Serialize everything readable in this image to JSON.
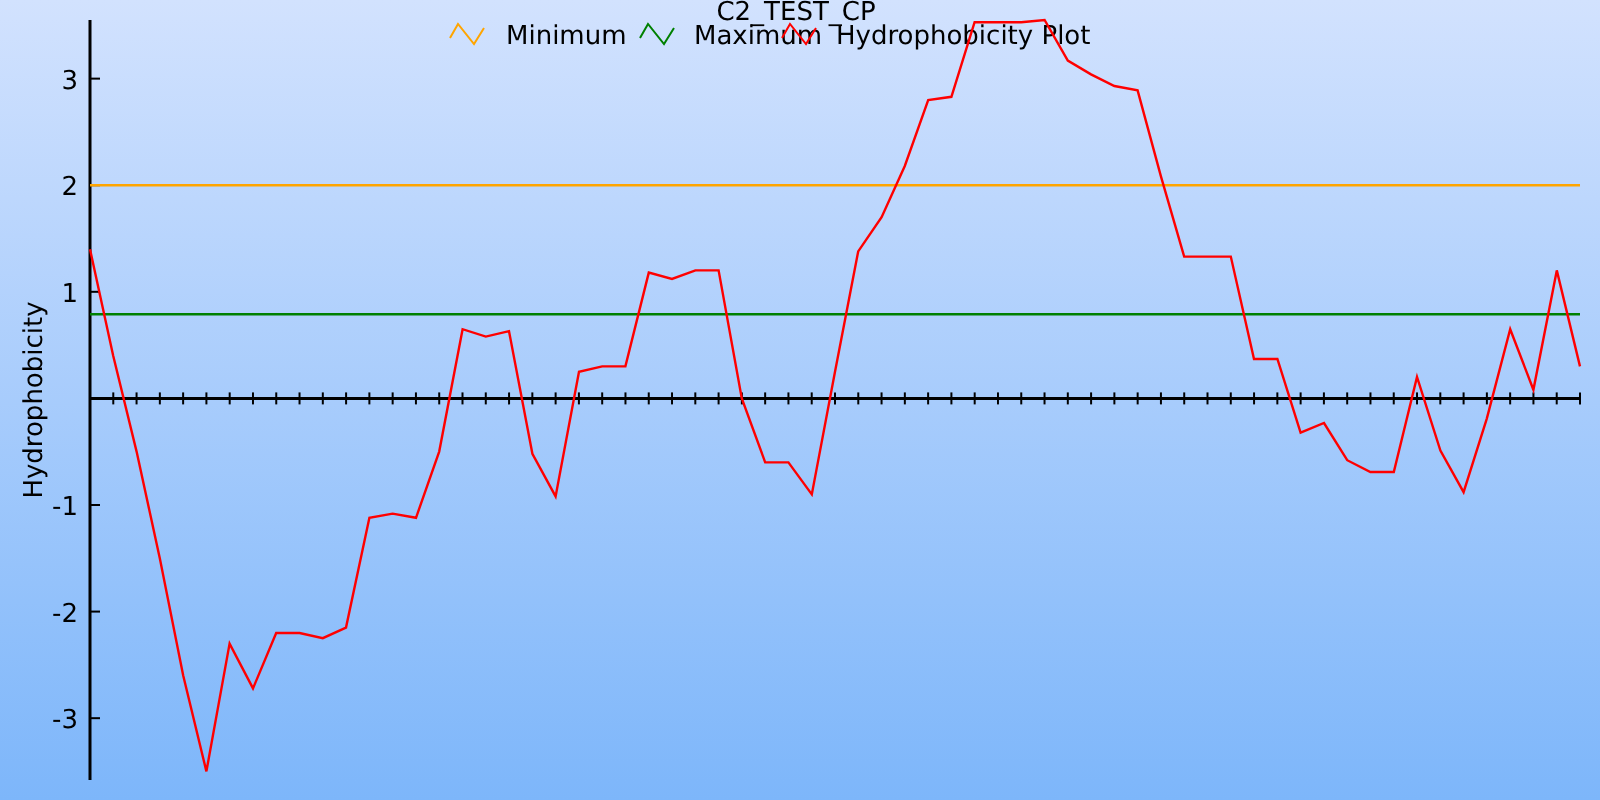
{
  "chart": {
    "chart_data": {
      "type": "line",
      "title": "C2_TEST_CP",
      "ylabel": "Hydrophobicity",
      "categories": [
        null,
        null,
        null,
        null,
        null,
        null,
        null,
        null,
        null,
        null,
        null,
        null,
        null,
        null,
        null,
        null,
        null,
        null,
        null,
        null,
        null,
        null,
        null,
        null,
        null,
        null,
        null,
        null,
        null,
        null,
        null,
        null,
        null,
        null,
        null,
        null,
        null,
        null,
        null,
        null,
        null,
        null,
        null,
        null,
        null,
        null,
        null,
        null,
        null,
        null,
        null,
        null,
        null,
        null,
        null,
        null,
        null,
        null,
        null,
        null,
        null,
        null,
        null,
        null,
        null
      ],
      "legend": "top",
      "ylim": [
        -3.58,
        3.55
      ],
      "yticks": [
        -3,
        -2,
        -1,
        1,
        2,
        3
      ],
      "series": [
        {
          "name": "Minimum",
          "color": "#ffa500",
          "values": [
            2,
            2,
            2,
            2,
            2,
            2,
            2,
            2,
            2,
            2,
            2,
            2,
            2,
            2,
            2,
            2,
            2,
            2,
            2,
            2,
            2,
            2,
            2,
            2,
            2,
            2,
            2,
            2,
            2,
            2,
            2,
            2,
            2,
            2,
            2,
            2,
            2,
            2,
            2,
            2,
            2,
            2,
            2,
            2,
            2,
            2,
            2,
            2,
            2,
            2,
            2,
            2,
            2,
            2,
            2,
            2,
            2,
            2,
            2,
            2,
            2,
            2,
            2,
            2,
            2
          ]
        },
        {
          "name": "Maximum",
          "color": "#008000",
          "values": [
            0.79,
            0.79,
            0.79,
            0.79,
            0.79,
            0.79,
            0.79,
            0.79,
            0.79,
            0.79,
            0.79,
            0.79,
            0.79,
            0.79,
            0.79,
            0.79,
            0.79,
            0.79,
            0.79,
            0.79,
            0.79,
            0.79,
            0.79,
            0.79,
            0.79,
            0.79,
            0.79,
            0.79,
            0.79,
            0.79,
            0.79,
            0.79,
            0.79,
            0.79,
            0.79,
            0.79,
            0.79,
            0.79,
            0.79,
            0.79,
            0.79,
            0.79,
            0.79,
            0.79,
            0.79,
            0.79,
            0.79,
            0.79,
            0.79,
            0.79,
            0.79,
            0.79,
            0.79,
            0.79,
            0.79,
            0.79,
            0.79,
            0.79,
            0.79,
            0.79,
            0.79,
            0.79,
            0.79,
            0.79,
            0.79
          ]
        },
        {
          "name": "Hydrophobicity Plot",
          "color": "#ff0000",
          "values": [
            1.4,
            0.4,
            -0.5,
            -1.5,
            -2.6,
            -3.5,
            -2.3,
            -2.72,
            -2.2,
            -2.2,
            -2.25,
            -2.15,
            -1.12,
            -1.08,
            -1.12,
            -0.5,
            0.65,
            0.58,
            0.63,
            -0.52,
            -0.92,
            0.25,
            0.3,
            0.3,
            1.18,
            1.12,
            1.2,
            1.2,
            0,
            -0.6,
            -0.6,
            -0.9,
            0.25,
            1.38,
            1.7,
            2.18,
            2.8,
            2.83,
            3.53,
            3.53,
            3.53,
            3.55,
            3.17,
            3.04,
            2.93,
            2.89,
            2.08,
            1.33,
            1.33,
            1.33,
            0.37,
            0.37,
            -0.32,
            -0.23,
            -0.58,
            -0.69,
            -0.69,
            0.2,
            -0.49,
            -0.88,
            -0.19,
            0.65,
            0.08,
            1.2,
            0.3
          ]
        }
      ]
    }
  }
}
